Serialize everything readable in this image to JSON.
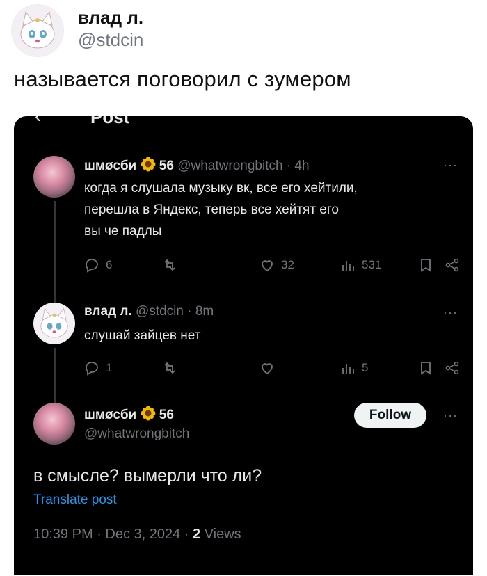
{
  "outer": {
    "name": "влад л.",
    "handle": "@stdcin",
    "text": "называется поговорил с зумером"
  },
  "screenshot": {
    "title": "Post",
    "tweet1": {
      "name": "шмøсби",
      "badge_icon": "sunflower-icon",
      "badge_count": "56",
      "handle": "@whatwrongbitch",
      "time": "4h",
      "lines": [
        "когда я слушала музыку вк, все его хейтили,",
        "перешла в Яндекс, теперь все хейтят его",
        "вы че падлы"
      ],
      "replies": "6",
      "likes": "32",
      "views": "531"
    },
    "tweet2": {
      "name": "влад л.",
      "handle": "@stdcin",
      "time": "8m",
      "text": "слушай зайцев нет",
      "replies": "1",
      "views": "5"
    },
    "tweet3": {
      "name": "шмøсби",
      "badge_count": "56",
      "handle": "@whatwrongbitch",
      "follow_label": "Follow",
      "text": "в смысле? вымерли что ли?",
      "translate": "Translate post",
      "datetime": "10:39 PM · Dec 3, 2024 · ",
      "views_count": "2",
      "views_label": " Views"
    },
    "colors": {
      "background": "#000000",
      "text": "#e7e9ea",
      "muted": "#71767b",
      "link": "#1d9bf0"
    }
  }
}
